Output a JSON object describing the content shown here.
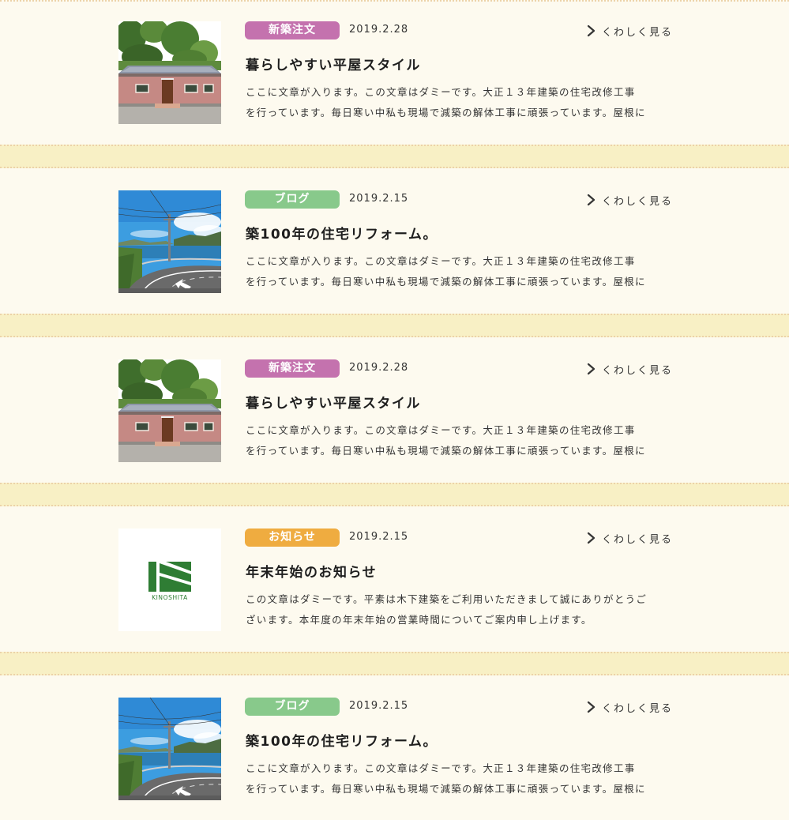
{
  "more_label": "くわしく見る",
  "colors": {
    "background": "#fdfaef",
    "separator_band": "#f8f0c5",
    "category_new_build": "#c472ae",
    "category_blog": "#88c98b",
    "category_notice": "#efac40"
  },
  "posts": [
    {
      "category": "新築注文",
      "date": "2019.2.28",
      "title": "暮らしやすい平屋スタイル",
      "excerpt_line1": "ここに文章が入ります。この文章はダミーです。大正１３年建築の住宅改修工事",
      "excerpt_line2": "を行っています。毎日寒い中私も現場で減築の解体工事に頑張っています。屋根に",
      "thumbnail": "house-photo"
    },
    {
      "category": "ブログ",
      "date": "2019.2.15",
      "title": "築100年の住宅リフォーム。",
      "excerpt_line1": "ここに文章が入ります。この文章はダミーです。大正１３年建築の住宅改修工事",
      "excerpt_line2": "を行っています。毎日寒い中私も現場で減築の解体工事に頑張っています。屋根に",
      "thumbnail": "road-photo"
    },
    {
      "category": "新築注文",
      "date": "2019.2.28",
      "title": "暮らしやすい平屋スタイル",
      "excerpt_line1": "ここに文章が入ります。この文章はダミーです。大正１３年建築の住宅改修工事",
      "excerpt_line2": "を行っています。毎日寒い中私も現場で減築の解体工事に頑張っています。屋根に",
      "thumbnail": "house-photo"
    },
    {
      "category": "お知らせ",
      "date": "2019.2.15",
      "title": "年末年始のお知らせ",
      "excerpt_line1": "この文章はダミーです。平素は木下建築をご利用いただきまして誠にありがとうご",
      "excerpt_line2": "ざいます。本年度の年末年始の営業時間についてご案内申し上げます。",
      "thumbnail": "kinoshita-logo",
      "logo_text": "KINOSHITA"
    },
    {
      "category": "ブログ",
      "date": "2019.2.15",
      "title": "築100年の住宅リフォーム。",
      "excerpt_line1": "ここに文章が入ります。この文章はダミーです。大正１３年建築の住宅改修工事",
      "excerpt_line2": "を行っています。毎日寒い中私も現場で減築の解体工事に頑張っています。屋根に",
      "thumbnail": "road-photo"
    }
  ]
}
